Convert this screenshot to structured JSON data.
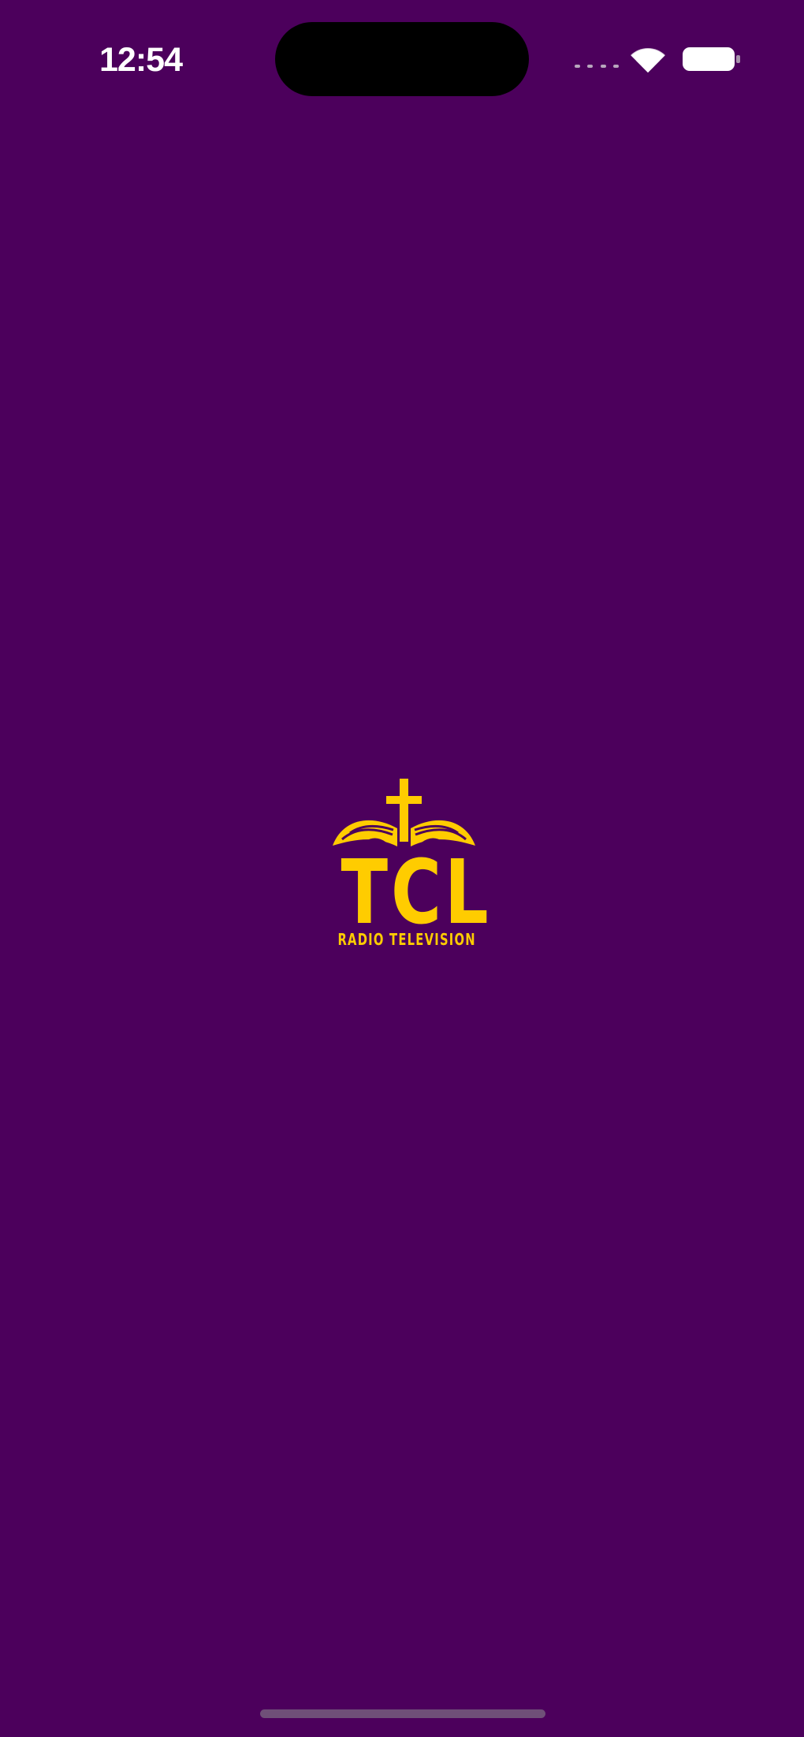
{
  "status_bar": {
    "time": "12:54",
    "icons": {
      "signal": "cellular-signal-icon",
      "wifi": "wifi-icon",
      "battery": "battery-icon"
    }
  },
  "logo": {
    "title": "TCL",
    "subtitle": "RADIO TELEVISION",
    "emblem": "cross-open-book-emblem"
  },
  "colors": {
    "background": "#4c005c",
    "logo": "#ffcc00",
    "status_text": "#ffffff"
  }
}
